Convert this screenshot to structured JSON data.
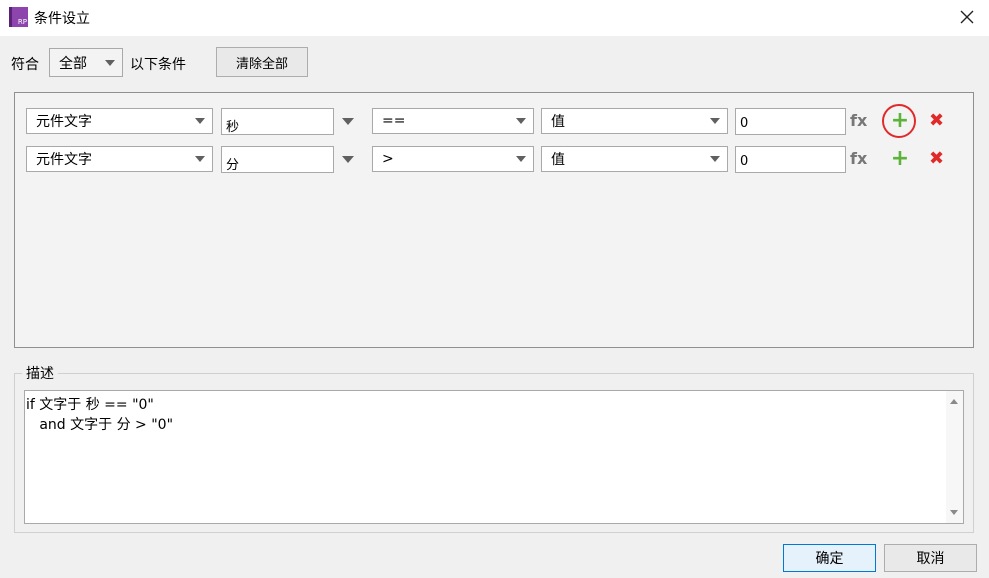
{
  "window": {
    "title": "条件设立",
    "app_icon_text": "RP"
  },
  "header": {
    "match_label": "符合",
    "match_selected": "全部",
    "suffix_label": "以下条件",
    "clear_all_label": "清除全部"
  },
  "conditions": [
    {
      "type": "元件文字",
      "target": "秒",
      "operator": "==",
      "value_type": "值",
      "value": "0",
      "fx": "fx",
      "add": "+",
      "remove": "✖"
    },
    {
      "type": "元件文字",
      "target": "分",
      "operator": ">",
      "value_type": "值",
      "value": "0",
      "fx": "fx",
      "add": "+",
      "remove": "✖"
    }
  ],
  "description": {
    "legend": "描述",
    "lines": [
      "if 文字于 秒 == \"0\"",
      "   and 文字于 分 > \"0\""
    ]
  },
  "footer": {
    "ok_label": "确定",
    "cancel_label": "取消"
  },
  "colors": {
    "accent_blue": "#0078d7",
    "add_green": "#5db33a",
    "delete_red": "#e02a2a",
    "highlight_circle": "#e02a2a"
  }
}
